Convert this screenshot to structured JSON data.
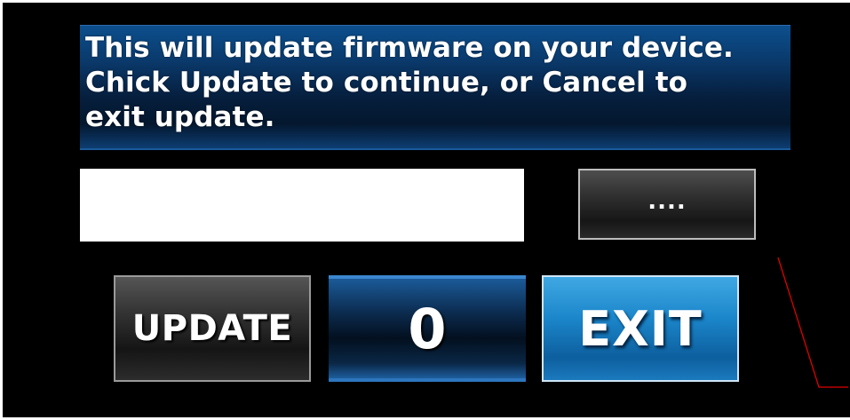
{
  "dialog": {
    "message": "This will update firmware on your device.\nChick Update to continue, or Cancel to\nexit update.",
    "file_path_value": "",
    "browse_label": "....",
    "update_label": "UPDATE",
    "counter_value": "0",
    "exit_label": "EXIT"
  },
  "colors": {
    "background": "#000000",
    "message_blue": "#0a3a6c",
    "exit_blue": "#1b86ca",
    "annotation_red": "#e00000"
  }
}
